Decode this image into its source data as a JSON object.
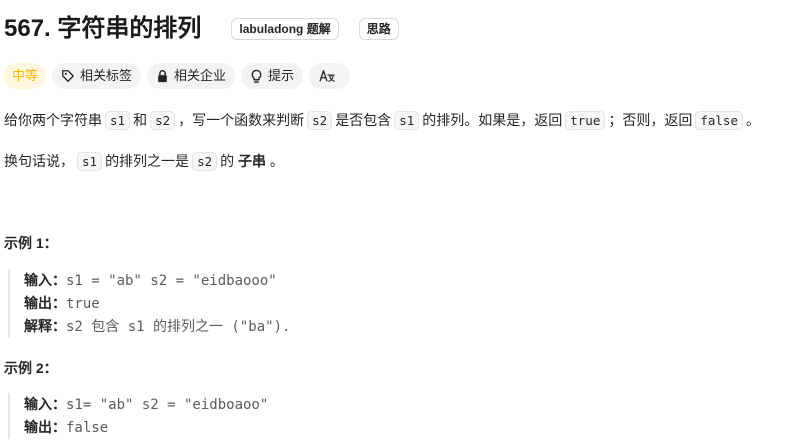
{
  "problem": {
    "title": "567. 字符串的排列",
    "solution_tag": "labuladong 题解",
    "idea_tag": "思路"
  },
  "chips": {
    "difficulty": "中等",
    "related_tags": "相关标签",
    "related_companies": "相关企业",
    "hint": "提示",
    "translate_icon": "translate-icon"
  },
  "description": {
    "p1": {
      "t1": "给你两个字符串",
      "c1": "s1",
      "t2": "和",
      "c2": "s2",
      "t3": "，写一个函数来判断",
      "c3": "s2",
      "t4": "是否包含",
      "c4": "s1",
      "t5": "的排列。如果是，返回",
      "c5": "true",
      "t6": "；否则，返回",
      "c6": "false",
      "t7": "。"
    },
    "p2": {
      "t1": "换句话说，",
      "c1": "s1",
      "t2": "的排列之一是",
      "c2": "s2",
      "t3": "的",
      "strong": "子串",
      "t4": "。"
    }
  },
  "examples": [
    {
      "title": "示例 1：",
      "input_label": "输入：",
      "input_value": "s1 = \"ab\" s2 = \"eidbaooo\"",
      "output_label": "输出：",
      "output_value": "true",
      "explain_label": "解释：",
      "explain_value": "s2 包含 s1 的排列之一 (\"ba\")."
    },
    {
      "title": "示例 2：",
      "input_label": "输入：",
      "input_value": "s1= \"ab\" s2 = \"eidboaoo\"",
      "output_label": "输出：",
      "output_value": "false"
    }
  ],
  "colors": {
    "difficulty_medium": "#ffb800",
    "chip_bg": "#f2f3f4",
    "text": "#262626",
    "code_text": "#5c5c5c"
  }
}
